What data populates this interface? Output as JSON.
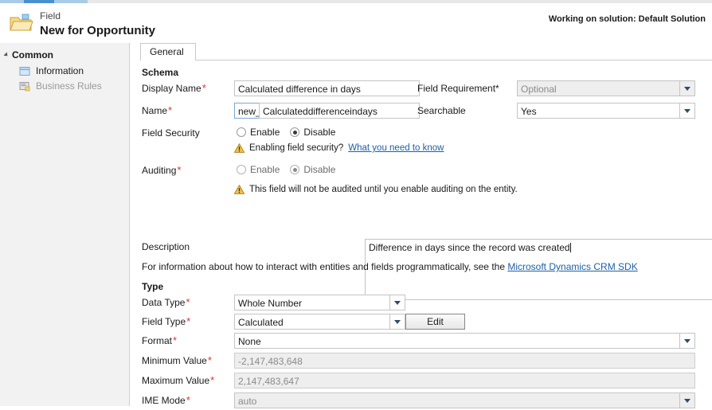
{
  "header": {
    "eyebrow": "Field",
    "title": "New for Opportunity",
    "solution_note": "Working on solution: Default Solution",
    "folder_icon": "folder-icon"
  },
  "sidebar": {
    "group_label": "Common",
    "items": [
      {
        "label": "Information",
        "icon": "information-icon"
      },
      {
        "label": "Business Rules",
        "icon": "business-rules-icon"
      }
    ]
  },
  "tabs": [
    {
      "label": "General"
    }
  ],
  "sections": {
    "schema": "Schema",
    "type": "Type"
  },
  "schema": {
    "display_name": {
      "label": "Display Name",
      "required": "*",
      "value": "Calculated difference in days"
    },
    "field_requirement": {
      "label": "Field Requirement",
      "required": "*",
      "value": "Optional"
    },
    "name": {
      "label": "Name",
      "required": "*",
      "prefix": "new_",
      "value": "Calculateddifferenceindays"
    },
    "searchable": {
      "label": "Searchable",
      "value": "Yes"
    },
    "field_security": {
      "label": "Field Security",
      "enable_label": "Enable",
      "disable_label": "Disable",
      "selected": "Disable"
    },
    "field_security_warning": {
      "text": "Enabling field security?",
      "link": "What you need to know",
      "icon": "warning-icon"
    },
    "auditing": {
      "label": "Auditing",
      "required": "*",
      "enable_label": "Enable",
      "disable_label": "Disable",
      "selected": "Disable"
    },
    "auditing_warning": {
      "text": "This field will not be audited until you enable auditing on the entity.",
      "icon": "warning-icon"
    },
    "description": {
      "label": "Description",
      "value": "Difference in days since the record was created"
    }
  },
  "sdk_note": {
    "text": "For information about how to interact with entities and fields programmatically, see the",
    "link": "Microsoft Dynamics CRM SDK"
  },
  "type": {
    "data_type": {
      "label": "Data Type",
      "required": "*",
      "value": "Whole Number"
    },
    "field_type": {
      "label": "Field Type",
      "required": "*",
      "value": "Calculated"
    },
    "edit_button": "Edit",
    "format": {
      "label": "Format",
      "required": "*",
      "value": "None"
    },
    "minimum_value": {
      "label": "Minimum Value",
      "required": "*",
      "value": "-2,147,483,648"
    },
    "maximum_value": {
      "label": "Maximum Value",
      "required": "*",
      "value": "2,147,483,647"
    },
    "ime_mode": {
      "label": "IME Mode",
      "required": "*",
      "value": "auto"
    }
  },
  "colors": {
    "required_marker": "#e03030",
    "link": "#1c5fa8",
    "warning": "#f2c14b",
    "progress_accent": "#4a90cd",
    "sidebar_bg": "#f2f2f2"
  }
}
